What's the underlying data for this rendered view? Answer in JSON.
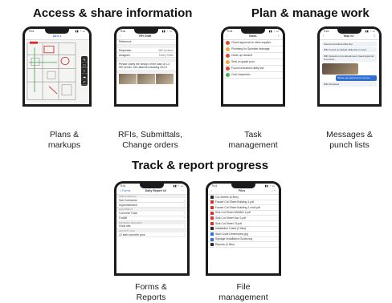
{
  "headings": {
    "access": "Access & share information",
    "plan": "Plan & manage work",
    "track": "Track & report progress"
  },
  "captions": {
    "plans": [
      "Plans &",
      "markups"
    ],
    "rfis": [
      "RFIs, Submittals,",
      "Change orders"
    ],
    "tasks": [
      "Task",
      "management"
    ],
    "messages": [
      "Messages &",
      "punch lists"
    ],
    "forms": [
      "Forms &",
      "Reports"
    ],
    "files": [
      "File",
      "management"
    ]
  },
  "status_time": "9:41",
  "phones": {
    "drawing": {
      "title": "A3.0.1"
    },
    "rfi": {
      "title": "RFI Draft",
      "rows": [
        {
          "label": "Reference",
          "value": ""
        },
        {
          "label": "Requester",
          "value": "Will Jackson"
        },
        {
          "label": "Assignee",
          "value": "Kathy Smith"
        }
      ],
      "body": "Please clarify the design of the stair on L3 Hill Center. See attached drawing S3.01"
    },
    "tasks": {
      "title": "Tasks",
      "items": [
        {
          "name": "Check approval on steel supplier",
          "color": "#e0442e"
        },
        {
          "name": "Plumbing for Sprinkler drainage",
          "color": "#f0a93b"
        },
        {
          "name": "Clean up needed",
          "color": "#e0442e"
        },
        {
          "name": "Seal on grade pour",
          "color": "#f0a93b"
        },
        {
          "name": "Found unmarked utility line",
          "color": "#e0442e"
        },
        {
          "name": "Curb inspection",
          "color": "#4caf50"
        }
      ]
    },
    "messages": {
      "title": "Task #4",
      "items": [
        {
          "text": "Found unmarked utility line",
          "me": false
        },
        {
          "text": "Will: Found unmarked utility line in road",
          "me": false
        },
        {
          "text": "Will: Appears to be abandoned. Need approval to remove.",
          "me": false
        },
        {
          "text": "Please get approval to remove",
          "me": true
        },
        {
          "text": "Will: Resolved",
          "me": false
        }
      ]
    },
    "daily": {
      "title": "Daily Report #2",
      "back": "< Forms",
      "sections": [
        "CREW DETAILS",
        "EQUIPMENT",
        "MATERIAL DELIVERY",
        "ACTIVITY LOG"
      ],
      "rows": [
        {
          "label": "Sub Contractor",
          "value": ""
        },
        {
          "label": "Superintendent",
          "value": ""
        },
        {
          "label": "Concrete Truck",
          "value": ""
        },
        {
          "label": "Forklift",
          "value": ""
        },
        {
          "label": "Good site",
          "value": ""
        },
        {
          "label": "12 slab concrete pour",
          "value": ""
        }
      ]
    },
    "files": {
      "title": "Files",
      "items": [
        {
          "name": "Cut Sheets (6 files)",
          "kind": "folder"
        },
        {
          "name": "Faucet Cut Sheet Building 1.pdf",
          "kind": "pdf"
        },
        {
          "name": "Faucet Cut Sheet Building 2 chull.pdf",
          "kind": "pdf"
        },
        {
          "name": "Sink Cut Sheet NNNNS 1.pdf",
          "kind": "pdf"
        },
        {
          "name": "Sink Cut Sheet Nav 2.pdf",
          "kind": "pdf"
        },
        {
          "name": "Sink Cut Sheet 76.pdf",
          "kind": "pdf"
        },
        {
          "name": "Installation Guide (2 files)",
          "kind": "folder"
        },
        {
          "name": "Wall Count Dimensions.jpg",
          "kind": "img"
        },
        {
          "name": "Signage Installation Guide.png",
          "kind": "img"
        },
        {
          "name": "Reports (4 files)",
          "kind": "folder"
        }
      ]
    }
  }
}
